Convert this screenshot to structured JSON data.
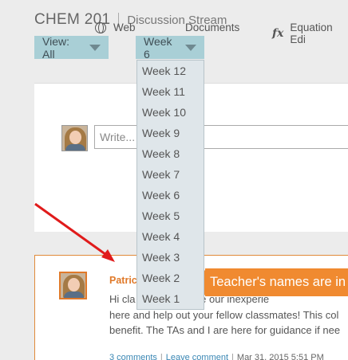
{
  "header": {
    "course": "CHEM 201",
    "subtitle": "Discussion Stream"
  },
  "filters": {
    "view_label": "View: All",
    "week_label": "Week 6"
  },
  "compose": {
    "tools": [
      {
        "label": "Web",
        "icon": "globe-icon"
      },
      {
        "label": "Documents",
        "icon": "document-icon"
      },
      {
        "label": "Equation Edi",
        "icon": "fx-icon"
      }
    ],
    "placeholder": "Write..."
  },
  "week_dropdown": {
    "items": [
      "Week 12",
      "Week 11",
      "Week 10",
      "Week 9",
      "Week 8",
      "Week 7",
      "Week 6",
      "Week 5",
      "Week 4",
      "Week 3",
      "Week 2",
      "Week 1"
    ]
  },
  "post": {
    "author": "Patricia Epperly",
    "lines": [
      "Hi cla           ce to celebrate our inexperie",
      "here and help out your fellow classmates! This col",
      "benefit. The TAs and I are here  for guidance if nee"
    ],
    "comments_link": "3 comments",
    "leave_comment_link": "Leave comment",
    "timestamp": "Mar 31, 2015 5:51 PM"
  },
  "annotation": {
    "callout_text": "Teacher's names are in",
    "color": "#f08a30",
    "arrow_color": "#e01b1b"
  }
}
